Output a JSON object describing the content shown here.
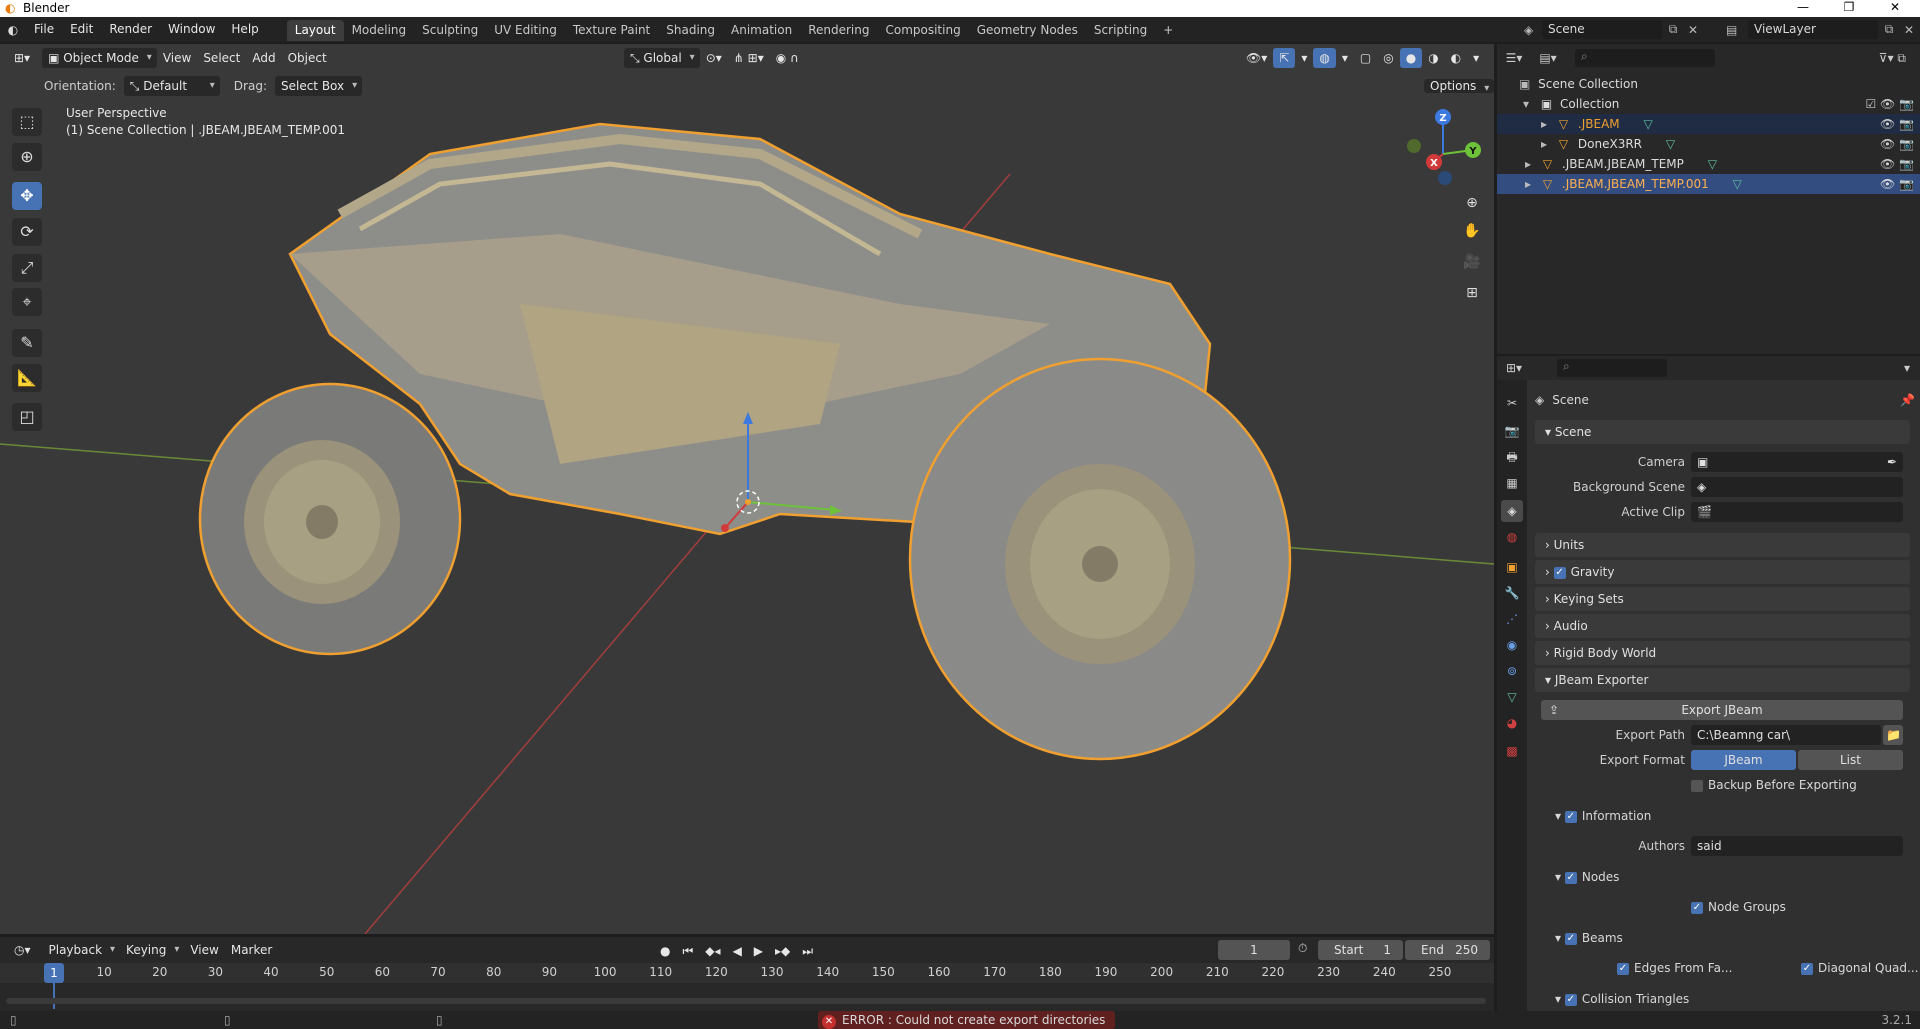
{
  "window": {
    "title": "Blender",
    "controls": [
      "—",
      "❐",
      "✕"
    ]
  },
  "menu": [
    "File",
    "Edit",
    "Render",
    "Window",
    "Help"
  ],
  "workspaces": [
    "Layout",
    "Modeling",
    "Sculpting",
    "UV Editing",
    "Texture Paint",
    "Shading",
    "Animation",
    "Rendering",
    "Compositing",
    "Geometry Nodes",
    "Scripting"
  ],
  "active_workspace": "Layout",
  "scene_selector": "Scene",
  "viewlayer_selector": "ViewLayer",
  "viewport": {
    "mode": "Object Mode",
    "menus": [
      "View",
      "Select",
      "Add",
      "Object"
    ],
    "transform_orientation": "Global",
    "orientation_label": "Orientation:",
    "orientation_value": "Default",
    "drag_label": "Drag:",
    "drag_value": "Select Box",
    "options_label": "Options",
    "overlay_title": "User Perspective",
    "overlay_subtitle": "(1) Scene Collection | .JBEAM.JBEAM_TEMP.001",
    "gizmo_axes": {
      "z": "Z",
      "y": "Y",
      "x": "X"
    }
  },
  "outliner": {
    "root": "Scene Collection",
    "items": [
      {
        "label": "Collection",
        "depth": 1
      },
      {
        "label": ".JBEAM",
        "depth": 2
      },
      {
        "label": "DoneX3RR",
        "depth": 2
      },
      {
        "label": ".JBEAM.JBEAM_TEMP",
        "depth": 1
      },
      {
        "label": ".JBEAM.JBEAM_TEMP.001",
        "depth": 1
      }
    ]
  },
  "properties": {
    "context_title": "Scene",
    "scene_panel": "Scene",
    "camera_label": "Camera",
    "bg_scene_label": "Background Scene",
    "active_clip_label": "Active Clip",
    "collapsed_panels": [
      "Units",
      "Gravity",
      "Keying Sets",
      "Audio",
      "Rigid Body World"
    ],
    "jbeam_panel": "JBeam Exporter",
    "export_button": "Export JBeam",
    "export_path_label": "Export Path",
    "export_path_value": "C:\\Beamng car\\",
    "export_format_label": "Export Format",
    "format_options": [
      "JBeam",
      "List"
    ],
    "backup_label": "Backup Before Exporting",
    "information_label": "Information",
    "authors_label": "Authors",
    "authors_value": "said",
    "nodes_label": "Nodes",
    "node_groups_label": "Node Groups",
    "beams_label": "Beams",
    "edges_label": "Edges From Fa...",
    "diagonal_label": "Diagonal Quad...",
    "collision_label": "Collision Triangles"
  },
  "timeline": {
    "menus": [
      "Playback",
      "Keying",
      "View",
      "Marker"
    ],
    "current_frame": "1",
    "start_label": "Start",
    "start_value": "1",
    "end_label": "End",
    "end_value": "250",
    "ticks": [
      "10",
      "20",
      "30",
      "40",
      "50",
      "60",
      "70",
      "80",
      "90",
      "100",
      "110",
      "120",
      "130",
      "140",
      "150",
      "160",
      "170",
      "180",
      "190",
      "200",
      "210",
      "220",
      "230",
      "240",
      "250"
    ],
    "playhead": "1"
  },
  "status": {
    "error": "ERROR : Could not create export directories",
    "version": "3.2.1"
  },
  "colors": {
    "accent": "#4772b3",
    "selection_outline": "#f0a030",
    "error": "#c23030"
  }
}
